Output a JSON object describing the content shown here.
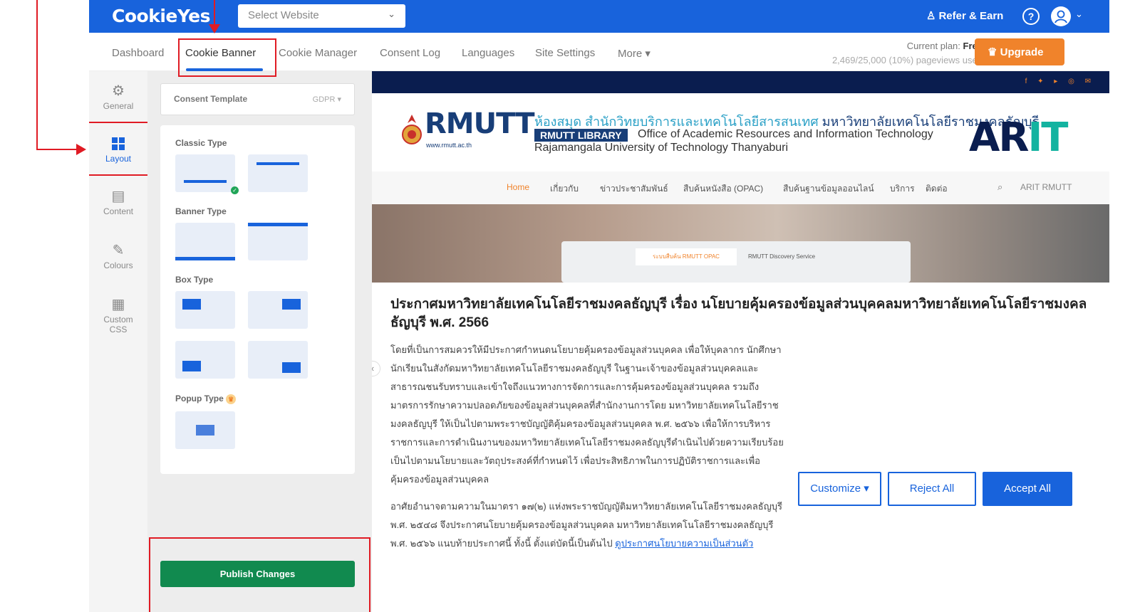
{
  "topbar": {
    "logo": "CookieYes",
    "site_select_placeholder": "Select Website",
    "refer_label": "Refer & Earn",
    "help_icon": "?"
  },
  "nav": {
    "tabs": [
      {
        "label": "Dashboard"
      },
      {
        "label": "Cookie Banner"
      },
      {
        "label": "Cookie Manager"
      },
      {
        "label": "Consent Log"
      },
      {
        "label": "Languages"
      },
      {
        "label": "Site Settings"
      },
      {
        "label": "More ▾"
      }
    ],
    "active_tab": "Cookie Banner",
    "plan_label": "Current plan:",
    "plan_value": "Free",
    "usage": "2,469/25,000 (10%) pageviews used",
    "upgrade_label": "Upgrade"
  },
  "sidebar": {
    "items": [
      {
        "label": "General",
        "icon": "gear-icon"
      },
      {
        "label": "Layout",
        "icon": "grid-icon"
      },
      {
        "label": "Content",
        "icon": "document-icon"
      },
      {
        "label": "Colours",
        "icon": "paint-icon"
      },
      {
        "label": "Custom CSS",
        "icon": "css-icon"
      }
    ],
    "active": "Layout"
  },
  "settings": {
    "template_label": "Consent Template",
    "template_value": "GDPR ▾",
    "sections": {
      "classic": "Classic Type",
      "banner": "Banner Type",
      "box": "Box Type",
      "popup": "Popup Type"
    },
    "selected_layout": "classic-bottom",
    "publish_label": "Publish Changes"
  },
  "preview": {
    "rmutt": "RMUTT",
    "rmutt_url": "www.rmutt.ac.th",
    "thai_library_a": "ห้องสมุด สำนักวิทยบริการและเทคโนโลยีสารสนเทศ",
    "thai_library_b": " มหาวิทยาลัยเทคโนโลยีราชมงคลธัญบุรี",
    "lib_tag": "RMUTT LIBRARY",
    "office": "Office of Academic Resources and Information Technology",
    "university": "Rajamangala University of Technology Thanyaburi",
    "arit_a": "AR",
    "arit_b": "IT",
    "site_nav": [
      "Home",
      "เกี่ยวกับ",
      "ข่าวประชาสัมพันธ์",
      "สืบค้นหนังสือ (OPAC)",
      "สืบค้นฐานข้อมูลออนไลน์",
      "บริการ",
      "ติดต่อ"
    ],
    "site_search_text": "ARIT RMUTT",
    "hero_tab1": "ระบบสืบค้น RMUTT OPAC",
    "hero_tab2": "RMUTT Discovery Service",
    "colors": {
      "accent": "#1863dc",
      "upgrade": "#f0832b",
      "publish": "#118a4f",
      "annotation": "#e01b24"
    }
  },
  "banner": {
    "title": "ประกาศมหาวิทยาลัยเทคโนโลยีราชมงคลธัญบุรี เรื่อง นโยบายคุ้มครองข้อมูลส่วนบุคคลมหาวิทยาลัยเทคโนโลยีราชมงคลธัญบุรี พ.ศ. 2566",
    "paragraph1": "โดยที่เป็นการสมควรให้มีประกาศกำหนดนโยบายคุ้มครองข้อมูลส่วนบุคคล เพื่อให้บุคลากร นักศึกษา นักเรียนในสังกัดมหาวิทยาลัยเทคโนโลยีราชมงคลธัญบุรี ในฐานะเจ้าของข้อมูลส่วนบุคคลและสาธารณชนรับทราบและเข้าใจถึงแนวทางการจัดการและการคุ้มครองข้อมูลส่วนบุคคล รวมถึงมาตรการรักษาความปลอดภัยของข้อมูลส่วนบุคคลที่สำนักงานการโดย มหาวิทยาลัยเทคโนโลยีราชมงคลธัญบุรี ให้เป็นไปตามพระราชบัญญัติคุ้มครองข้อมูลส่วนบุคคล พ.ศ. ๒๕๖๖ เพื่อให้การบริหารราชการและการดำเนินงานของมหาวิทยาลัยเทคโนโลยีราชมงคลธัญบุรีดำเนินไปด้วยความเรียบร้อย เป็นไปตามนโยบายและวัตถุประสงค์ที่กำหนดไว้ เพื่อประสิทธิภาพในการปฏิบัติราชการและเพื่อคุ้มครองข้อมูลส่วนบุคคล",
    "paragraph2": "อาศัยอำนาจตามความในมาตรา ๑๗(๒) แห่งพระราชบัญญัติมหาวิทยาลัยเทคโนโลยีราชมงคลธัญบุรี พ.ศ. ๒๕๔๘ จึงประกาศนโยบายคุ้มครองข้อมูลส่วนบุคคล มหาวิทยาลัยเทคโนโลยีราชมงคลธัญบุรี พ.ศ. ๒๕๖๖ แนบท้ายประกาศนี้ ทั้งนี้ ตั้งแต่บัดนี้เป็นต้นไป",
    "link": "ดูประกาศนโยบายความเป็นส่วนตัว",
    "customize_label": "Customize ▾",
    "reject_label": "Reject All",
    "accept_label": "Accept All"
  }
}
